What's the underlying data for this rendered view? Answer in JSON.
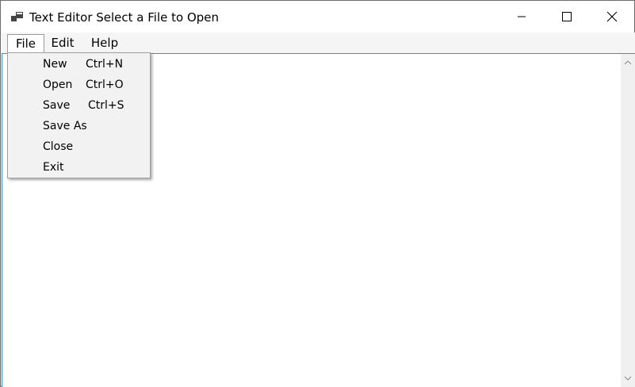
{
  "window": {
    "title": "Text Editor Select a File to Open",
    "icon": "app-windows-icon"
  },
  "caption_buttons": {
    "minimize": "minimize-icon",
    "maximize": "maximize-icon",
    "close": "close-icon"
  },
  "menubar": {
    "items": [
      {
        "label": "File",
        "active": true
      },
      {
        "label": "Edit",
        "active": false
      },
      {
        "label": "Help",
        "active": false
      }
    ]
  },
  "file_menu": {
    "items": [
      {
        "label": "New",
        "shortcut": "Ctrl+N"
      },
      {
        "label": "Open",
        "shortcut": "Ctrl+O"
      },
      {
        "label": "Save",
        "shortcut": "Ctrl+S"
      },
      {
        "label": "Save As",
        "shortcut": ""
      },
      {
        "label": "Close",
        "shortcut": ""
      },
      {
        "label": "Exit",
        "shortcut": ""
      }
    ]
  },
  "editor": {
    "content": ""
  },
  "colors": {
    "focus_border": "#3a8fd0",
    "menubar_bg": "#f5f5f5",
    "dropdown_bg": "#f2f2f2"
  }
}
